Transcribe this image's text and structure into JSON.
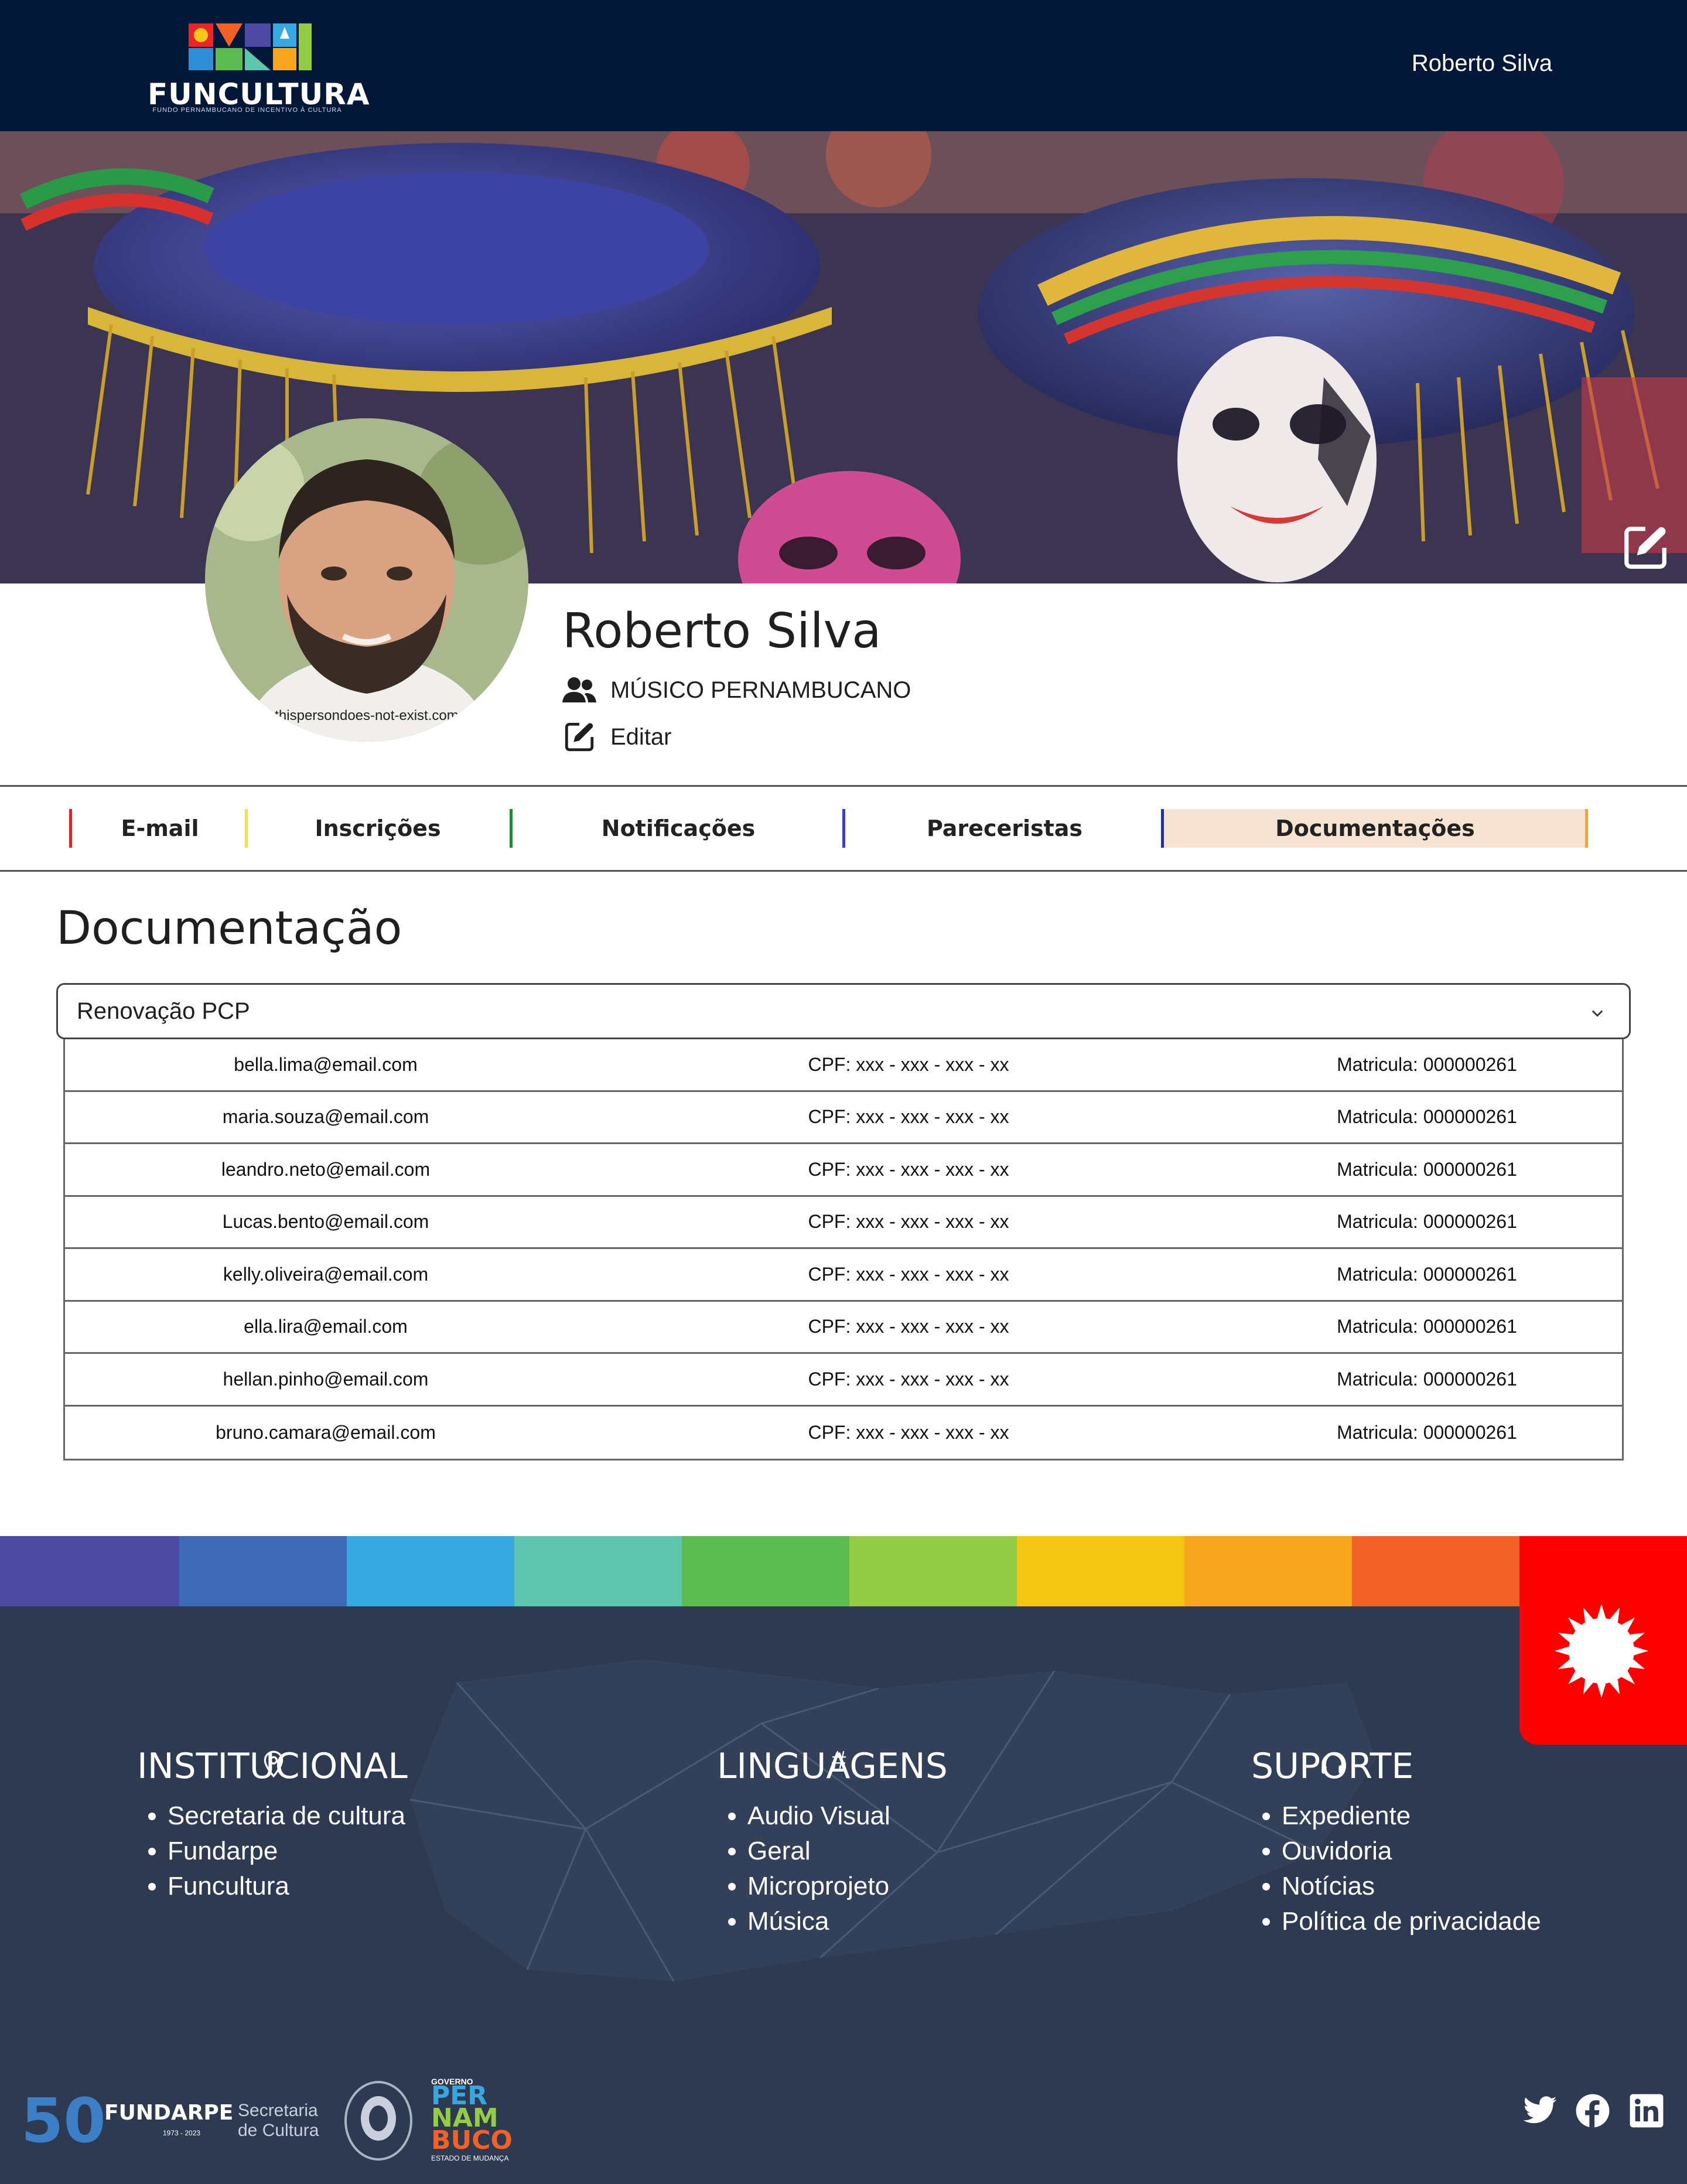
{
  "header": {
    "logo_text": "FUNCULTURA",
    "logo_subtitle": "FUNDO PERNAMBUCANO DE INCENTIVO À CULTURA",
    "user_name": "Roberto Silva"
  },
  "profile": {
    "name": "Roberto Silva",
    "role": "MÚSICO PERNAMBUCANO",
    "edit_label": "Editar",
    "avatar_watermark": "thispersondoes-not-exist.com"
  },
  "tabs": [
    {
      "label": "E-mail",
      "color": "#e0242b",
      "active": false
    },
    {
      "label": "Inscrições",
      "color": "#f4e04a",
      "active": false
    },
    {
      "label": "Notificações",
      "color": "#1c8a2e",
      "active": false
    },
    {
      "label": "Pareceristas",
      "color": "#3b3bd6",
      "active": false
    },
    {
      "label": "Documentações",
      "color": "#2430a8",
      "active": true
    }
  ],
  "section": {
    "title": "Documentação",
    "select_value": "Renovação PCP"
  },
  "table": {
    "rows": [
      {
        "email": "bella.lima@email.com",
        "cpf": "CPF: xxx - xxx - xxx - xx",
        "matricula": "Matricula: 000000261"
      },
      {
        "email": "maria.souza@email.com",
        "cpf": "CPF: xxx - xxx - xxx - xx",
        "matricula": "Matricula: 000000261"
      },
      {
        "email": "leandro.neto@email.com",
        "cpf": "CPF: xxx - xxx - xxx - xx",
        "matricula": "Matricula: 000000261"
      },
      {
        "email": "Lucas.bento@email.com",
        "cpf": "CPF: xxx - xxx - xxx - xx",
        "matricula": "Matricula: 000000261"
      },
      {
        "email": "kelly.oliveira@email.com",
        "cpf": "CPF: xxx - xxx - xxx - xx",
        "matricula": "Matricula: 000000261"
      },
      {
        "email": "ella.lira@email.com",
        "cpf": "CPF: xxx - xxx - xxx - xx",
        "matricula": "Matricula: 000000261"
      },
      {
        "email": "hellan.pinho@email.com",
        "cpf": "CPF: xxx - xxx - xxx - xx",
        "matricula": "Matricula: 000000261"
      },
      {
        "email": "bruno.camara@email.com",
        "cpf": "CPF: xxx - xxx - xxx - xx",
        "matricula": "Matricula: 000000261"
      }
    ]
  },
  "footer": {
    "stripe_colors": [
      "#4e4aa4",
      "#3e6ab8",
      "#38a8e2",
      "#5ec6ad",
      "#5bbb4e",
      "#95cc46",
      "#f4c614",
      "#f8a51f",
      "#f26227",
      "#ff0000"
    ],
    "columns": [
      {
        "icon": "map-pin-icon",
        "heading": "INSTITUCIONAL",
        "items": [
          "Secretaria de cultura",
          "Fundarpe",
          "Funcultura"
        ]
      },
      {
        "icon": "hash-icon",
        "icon_glyph": "#",
        "heading": "LINGUAGENS",
        "items": [
          "Audio Visual",
          "Geral",
          "Microprojeto",
          "Música"
        ]
      },
      {
        "icon": "headset-icon",
        "heading": "SUPORTE",
        "items": [
          "Expediente",
          "Ouvidoria",
          "Notícias",
          "Política de privacidade"
        ]
      }
    ],
    "partners": {
      "fundarpe_number": "50",
      "fundarpe_name": "FUNDARPE",
      "fundarpe_years": "1973 - 2023",
      "secretaria_line1": "Secretaria",
      "secretaria_line2": "de Cultura",
      "governo_top": "GOVERNO",
      "pe_line1": "PER",
      "pe_line2": "NAM",
      "pe_line3": "BUCO",
      "pe_tagline": "ESTADO DE MUDANÇA"
    },
    "social": [
      "twitter-icon",
      "facebook-icon",
      "linkedin-icon"
    ]
  }
}
